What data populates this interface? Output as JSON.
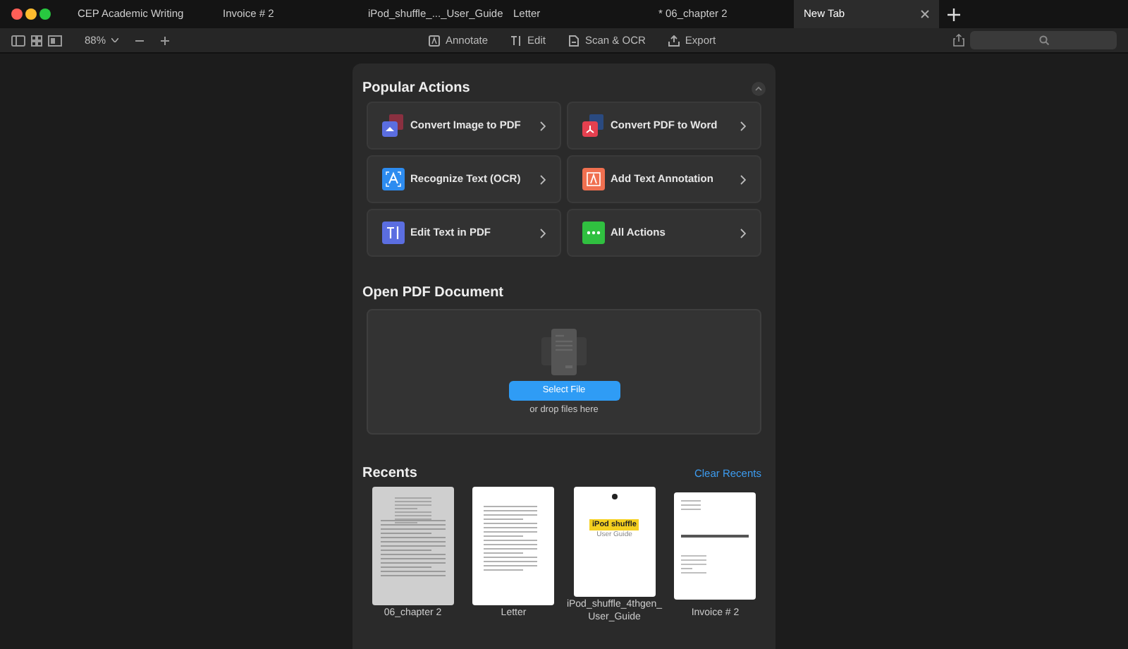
{
  "tabs": [
    {
      "label": "CEP Academic Writing",
      "selected": false
    },
    {
      "label": "Invoice # 2",
      "selected": false
    },
    {
      "label": "iPod_shuffle_..._User_Guide",
      "selected": false
    },
    {
      "label": "Letter",
      "selected": false
    },
    {
      "label": "* 06_chapter 2",
      "selected": false
    },
    {
      "label": "New Tab",
      "selected": true
    }
  ],
  "toolbar": {
    "zoom": "88%",
    "tools": [
      {
        "kind": "annotate",
        "label": "Annotate"
      },
      {
        "kind": "edit",
        "label": "Edit"
      },
      {
        "kind": "scan",
        "label": "Scan & OCR"
      },
      {
        "kind": "export",
        "label": "Export"
      }
    ]
  },
  "popular_actions": {
    "title": "Popular Actions",
    "items": [
      {
        "kind": "image",
        "label": "Convert Image to PDF",
        "color": "#5b6ee1"
      },
      {
        "kind": "word",
        "label": "Convert PDF to Word",
        "color": "#e5404f"
      },
      {
        "kind": "ocr",
        "label": "Recognize Text (OCR)",
        "color": "#2d8cf0"
      },
      {
        "kind": "annotate",
        "label": "Add Text Annotation",
        "color": "#f07050"
      },
      {
        "kind": "edit",
        "label": "Edit Text in PDF",
        "color": "#5b6ee1"
      },
      {
        "kind": "more",
        "label": "All Actions",
        "color": "#30c040"
      }
    ]
  },
  "open_document": {
    "title": "Open PDF Document",
    "button": "Select File",
    "hint": "or drop files here"
  },
  "recents": {
    "title": "Recents",
    "clear": "Clear Recents",
    "items": [
      {
        "kind": "scan",
        "name": "06_chapter 2"
      },
      {
        "kind": "letter",
        "name": "Letter"
      },
      {
        "kind": "cover",
        "name": "iPod_shuffle_4thgen_User_Guide",
        "cover_title": "iPod shuffle",
        "cover_subtitle": "User Guide"
      },
      {
        "kind": "invoice",
        "name": "Invoice # 2"
      }
    ]
  }
}
